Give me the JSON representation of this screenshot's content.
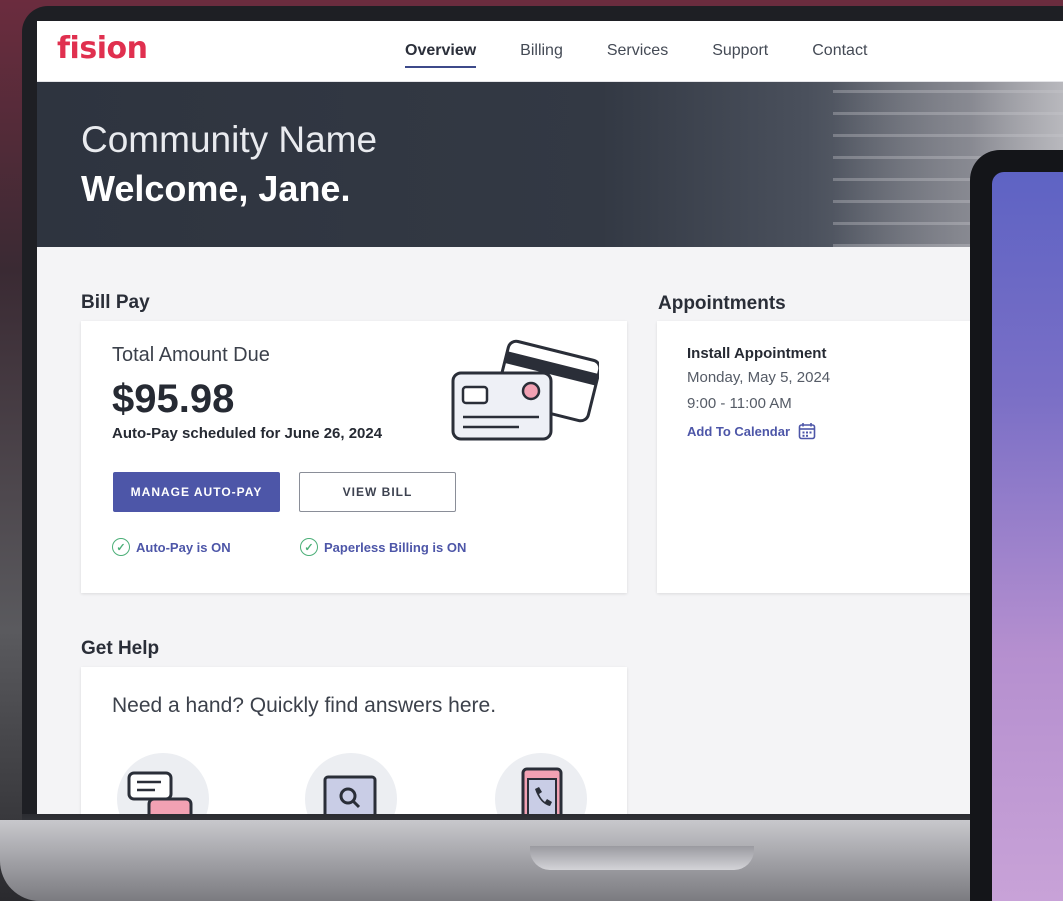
{
  "brand": {
    "logo": "fision",
    "accent": "#e0304f",
    "primary": "#4d56a8"
  },
  "nav": {
    "items": [
      {
        "label": "Overview",
        "active": true
      },
      {
        "label": "Billing",
        "active": false
      },
      {
        "label": "Services",
        "active": false
      },
      {
        "label": "Support",
        "active": false
      },
      {
        "label": "Contact",
        "active": false
      }
    ]
  },
  "hero": {
    "subtitle": "Community Name",
    "title": "Welcome, Jane."
  },
  "bill_pay": {
    "section_title": "Bill Pay",
    "label": "Total Amount Due",
    "amount": "$95.98",
    "note": "Auto-Pay scheduled for June 26, 2024",
    "manage_label": "MANAGE AUTO-PAY",
    "view_label": "VIEW BILL",
    "status_autopay": "Auto-Pay is ON",
    "status_paperless": "Paperless Billing is ON",
    "illustration_icon": "credit-cards-icon"
  },
  "appointments": {
    "section_title": "Appointments",
    "item": {
      "title": "Install Appointment",
      "date": "Monday, May 5, 2024",
      "time": "9:00 - 11:00 AM",
      "action": "Add To Calendar",
      "action_icon": "calendar-icon"
    }
  },
  "get_help": {
    "section_title": "Get Help",
    "text": "Need a hand?  Quickly find answers here.",
    "icons": [
      "chat-icon",
      "search-icon",
      "phone-icon"
    ]
  }
}
